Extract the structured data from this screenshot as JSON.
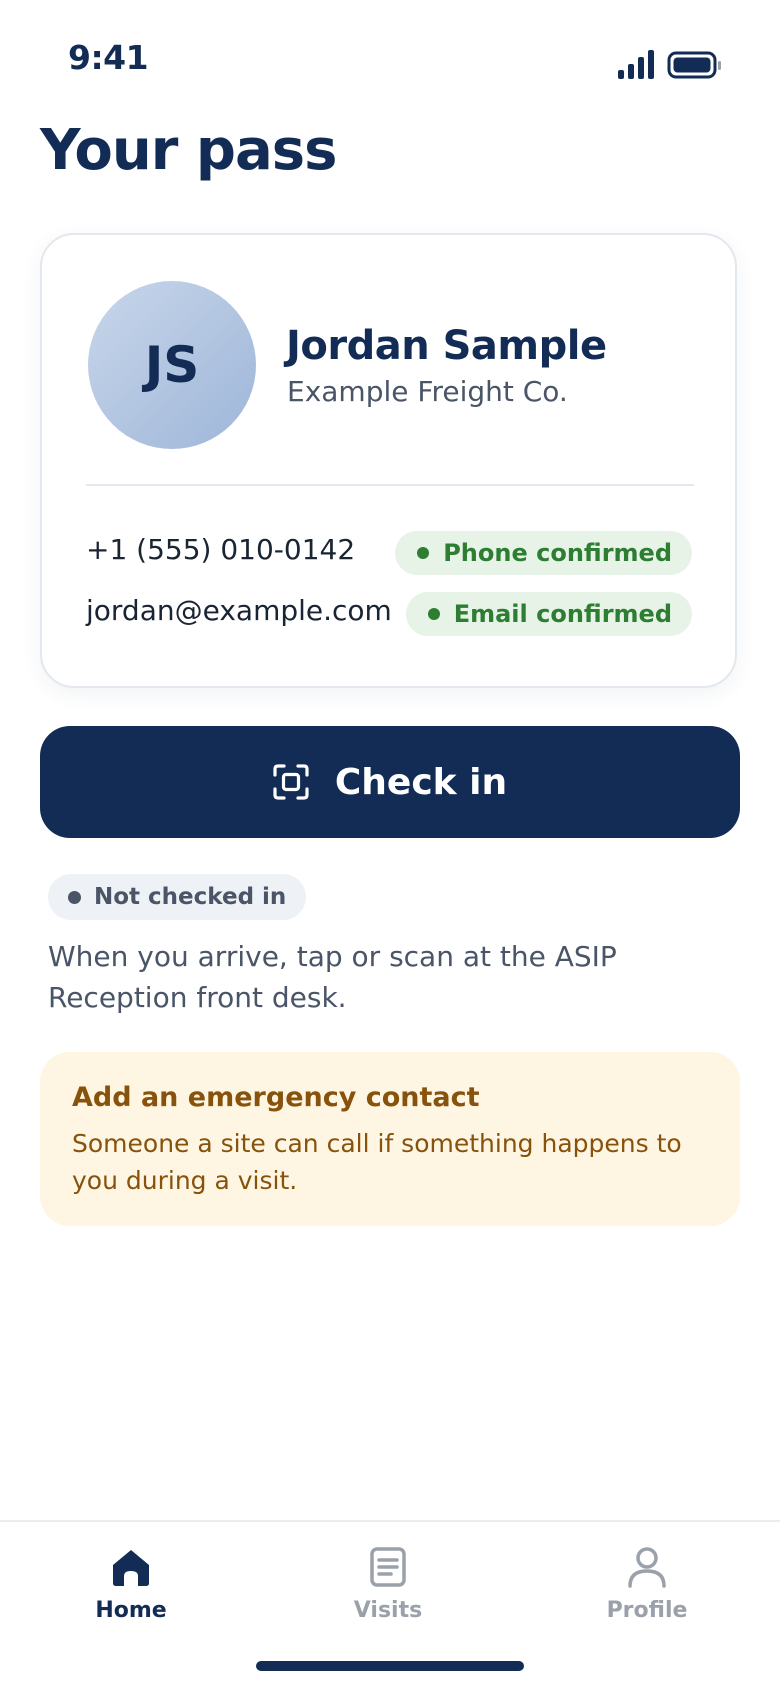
{
  "status_bar": {
    "time": "9:41",
    "signal_icon": "signal-bars-icon",
    "battery_icon": "battery-full-icon"
  },
  "page": {
    "title": "Your pass"
  },
  "pass": {
    "initials": "JS",
    "name": "Jordan Sample",
    "company": "Example Freight Co.",
    "phone": "+1 (555) 010-0142",
    "phone_status": "Phone confirmed",
    "email": "jordan@example.com",
    "email_status": "Email confirmed"
  },
  "checkin": {
    "button_label": "Check in",
    "icon": "scan-icon",
    "status": "Not checked in",
    "hint": "When you arrive, tap or scan at the ASIP Reception front desk."
  },
  "emergency": {
    "title": "Add an emergency contact",
    "description": "Someone a site can call if something happens to you during a visit."
  },
  "tabs": [
    {
      "label": "Home",
      "icon": "home-icon",
      "active": true
    },
    {
      "label": "Visits",
      "icon": "visits-list-icon",
      "active": false
    },
    {
      "label": "Profile",
      "icon": "profile-icon",
      "active": false
    }
  ],
  "colors": {
    "primary": "#122c55",
    "success": "#2d7d32",
    "success_bg": "#e6f3e6",
    "warning_text": "#87520b",
    "warning_bg": "#fef5e2",
    "muted": "#4a5568",
    "inactive_tab": "#9aa1aa"
  }
}
